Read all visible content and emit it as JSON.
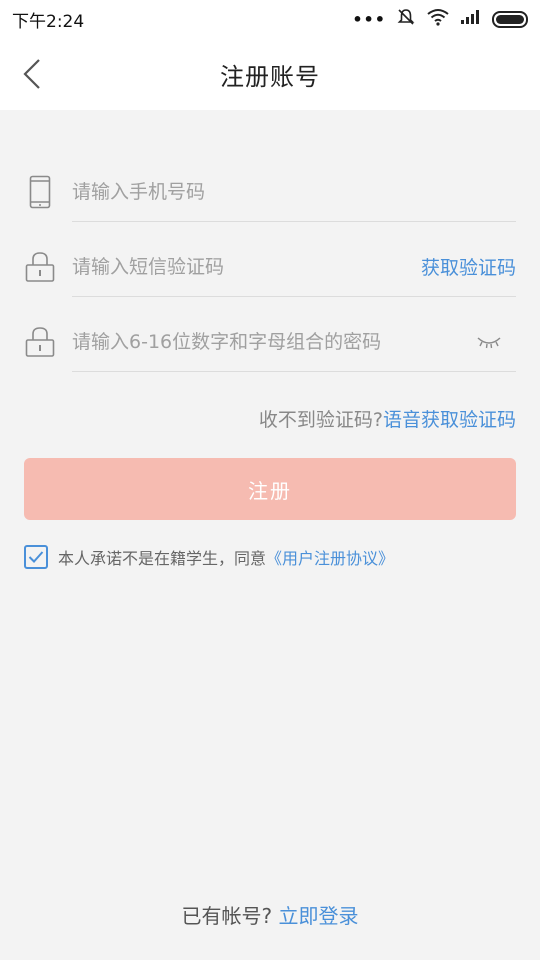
{
  "status_bar": {
    "time": "下午2:24",
    "icons": [
      "more-dots-icon",
      "mute-icon",
      "wifi-icon",
      "signal-icon",
      "battery-icon"
    ]
  },
  "header": {
    "back_icon": "chevron-left-icon",
    "title": "注册账号"
  },
  "form": {
    "phone": {
      "icon": "phone-icon",
      "placeholder": "请输入手机号码",
      "value": ""
    },
    "sms_code": {
      "icon": "lock-icon",
      "placeholder": "请输入短信验证码",
      "value": "",
      "get_code_label": "获取验证码"
    },
    "password": {
      "icon": "lock-icon",
      "placeholder": "请输入6-16位数字和字母组合的密码",
      "value": "",
      "toggle_icon": "eye-closed-icon"
    },
    "voice_prompt": "收不到验证码?",
    "voice_link": "语音获取验证码",
    "register_label": "注册",
    "agree_checked": true,
    "agree_text": "本人承诺不是在籍学生，同意",
    "agreement_link": "《用户注册协议》"
  },
  "footer": {
    "login_prompt": "已有帐号?",
    "login_link": "立即登录"
  },
  "colors": {
    "accent": "#4a90d9",
    "register_button": "#f6bbb1",
    "background": "#f3f3f3"
  }
}
